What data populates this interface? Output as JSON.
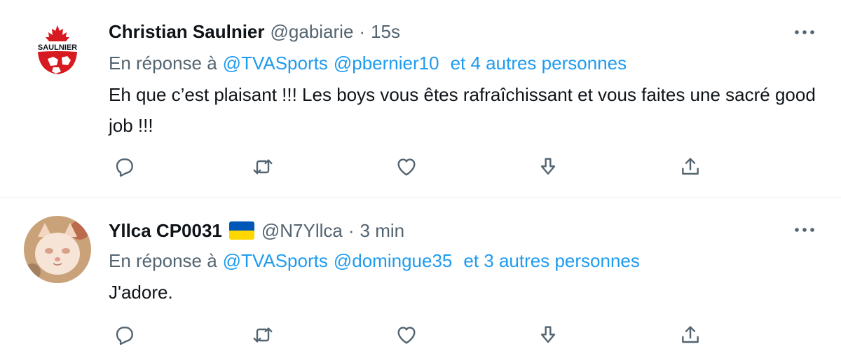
{
  "tweets": [
    {
      "display_name": "Christian Saulnier",
      "handle": "@gabiarie",
      "separator": "·",
      "time": "15s",
      "avatar_text": "SAULNIER",
      "reply_prefix": "En réponse à",
      "mentions": [
        "@TVASports",
        "@pbernier10"
      ],
      "others": "et 4 autres personnes",
      "text": "Eh que c’est plaisant !!! Les boys vous êtes rafraîchissant et vous faites une sacré good job !!!"
    },
    {
      "display_name": "Yllca CP0031",
      "handle": "@N7Yllca",
      "separator": "·",
      "time": "3 min",
      "reply_prefix": "En réponse à",
      "mentions": [
        "@TVASports",
        "@domingue35"
      ],
      "others": "et 3 autres personnes",
      "text": "J'adore."
    }
  ],
  "colors": {
    "accent": "#1d9bf0",
    "secondary_text": "#536471",
    "primary_text": "#0f1419",
    "divider": "#eff3f4",
    "flag_blue": "#0057b7",
    "flag_yellow": "#ffd700",
    "logo_red": "#d71920"
  },
  "icons": [
    "more-icon",
    "reply-icon",
    "retweet-icon",
    "like-icon",
    "download-icon",
    "share-icon"
  ]
}
